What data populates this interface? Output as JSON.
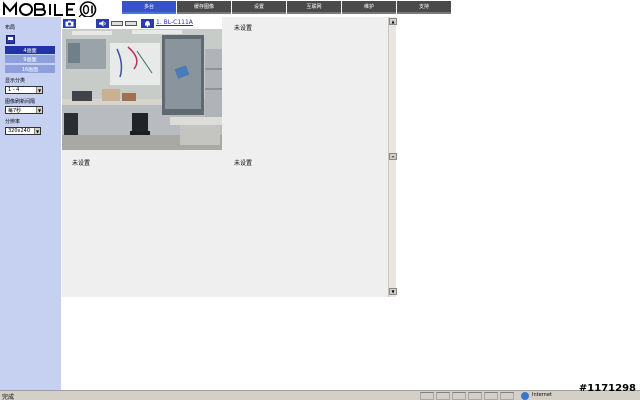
{
  "header": {
    "logo_text": "MOBILE01",
    "tabs": [
      {
        "label": "多台"
      },
      {
        "label": "缓存图像"
      },
      {
        "label": "设置"
      },
      {
        "label": "互联网"
      },
      {
        "label": "维护"
      },
      {
        "label": "支持"
      }
    ],
    "active_tab": "多台"
  },
  "sidebar": {
    "layout_label": "布局",
    "layout_options": [
      {
        "label": "4画面",
        "selected": true
      },
      {
        "label": "9画面",
        "selected": false
      },
      {
        "label": "16画面",
        "selected": false
      }
    ],
    "display_group_label": "显示分类",
    "display_group_value": "1 - 4",
    "refresh_label": "图像刷新间隔",
    "refresh_value": "每7秒",
    "resolution_label": "分辨率",
    "resolution_value": "320x240"
  },
  "main": {
    "camera": {
      "name": "1. BL-C111A"
    },
    "unset_label": "未设置",
    "cells": [
      "未设置",
      "未设置",
      "未设置"
    ]
  },
  "statusbar": {
    "left_text": "完成",
    "zone_text": "Internet"
  },
  "watermark": "#1171298",
  "colors": {
    "accent": "#2233aa",
    "sidebar_bg": "#c6d0f0",
    "tab_bg": "#4a4a4a",
    "content_bg": "#efefef"
  }
}
